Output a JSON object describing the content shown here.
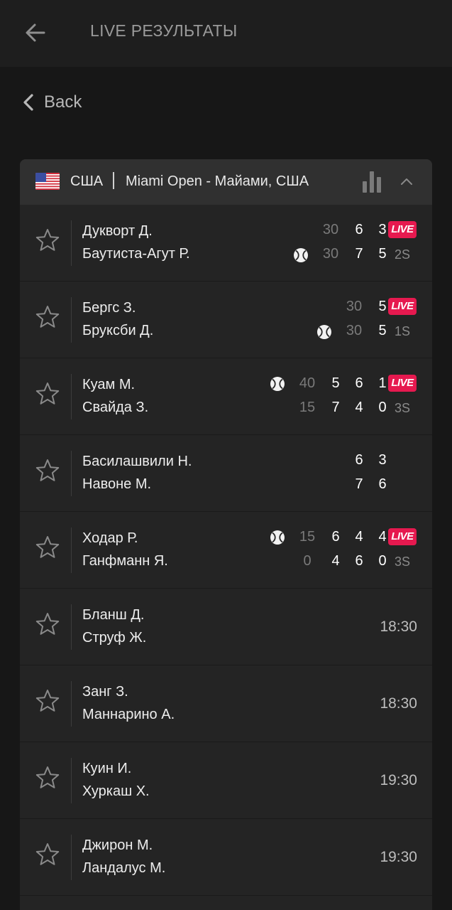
{
  "header": {
    "title": "LIVE РЕЗУЛЬТАТЫ",
    "back_icon": "arrow-left-icon"
  },
  "nav": {
    "back_label": "Back"
  },
  "tournament": {
    "country": "США",
    "name": "Miami Open - Майами, США",
    "flag": "us-flag-icon"
  },
  "labels": {
    "live": "LIVE"
  },
  "matches": [
    {
      "p1": "Дукворт Д.",
      "p2": "Баутиста-Агут Р.",
      "points": [
        "30",
        "30"
      ],
      "sets1": [
        "6",
        "3"
      ],
      "sets2": [
        "7",
        "5"
      ],
      "set": "2S",
      "serving": 2,
      "status": "live"
    },
    {
      "p1": "Бергс З.",
      "p2": "Бруксби Д.",
      "points": [
        "30",
        "30"
      ],
      "sets1": [
        "5"
      ],
      "sets2": [
        "5"
      ],
      "set": "1S",
      "serving": 2,
      "status": "live"
    },
    {
      "p1": "Куам М.",
      "p2": "Свайда З.",
      "points": [
        "40",
        "15"
      ],
      "sets1": [
        "5",
        "6",
        "1"
      ],
      "sets2": [
        "7",
        "4",
        "0"
      ],
      "set": "3S",
      "serving": 1,
      "status": "live"
    },
    {
      "p1": "Басилашвили Н.",
      "p2": "Навоне М.",
      "sets1": [
        "6",
        "3"
      ],
      "sets2": [
        "7",
        "6"
      ],
      "status": "finished"
    },
    {
      "p1": "Ходар Р.",
      "p2": "Ганфманн Я.",
      "points": [
        "15",
        "0"
      ],
      "sets1": [
        "6",
        "4",
        "4"
      ],
      "sets2": [
        "4",
        "6",
        "0"
      ],
      "set": "3S",
      "serving": 1,
      "status": "live"
    },
    {
      "p1": "Бланш Д.",
      "p2": "Струф Ж.",
      "time": "18:30",
      "status": "scheduled"
    },
    {
      "p1": "Занг З.",
      "p2": "Маннарино А.",
      "time": "18:30",
      "status": "scheduled"
    },
    {
      "p1": "Куин И.",
      "p2": "Хуркаш Х.",
      "time": "19:30",
      "status": "scheduled"
    },
    {
      "p1": "Джирон М.",
      "p2": "Ландалус М.",
      "time": "19:30",
      "status": "scheduled"
    }
  ],
  "colors": {
    "live": "#e6194f",
    "background": "#171717",
    "card": "#242424",
    "card_header": "#303030"
  }
}
